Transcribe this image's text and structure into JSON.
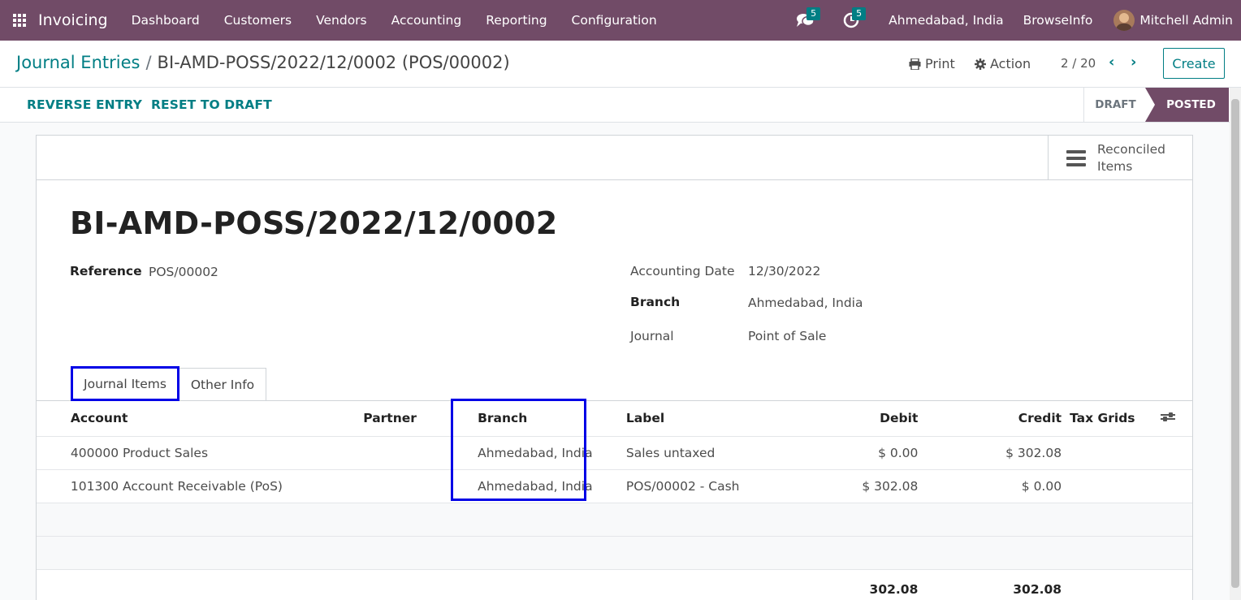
{
  "navbar": {
    "app_name": "Invoicing",
    "menu": [
      "Dashboard",
      "Customers",
      "Vendors",
      "Accounting",
      "Reporting",
      "Configuration"
    ],
    "messages_count": "5",
    "activities_count": "5",
    "branch": "Ahmedabad, India",
    "company": "BrowseInfo",
    "user": "Mitchell Admin"
  },
  "breadcrumb": {
    "parent": "Journal Entries",
    "separator": "/",
    "current": "BI-AMD-POSS/2022/12/0002 (POS/00002)"
  },
  "actions": {
    "print": "Print",
    "action": "Action",
    "pager": "2 / 20",
    "create": "Create"
  },
  "statusbar": {
    "reverse_entry": "REVERSE ENTRY",
    "reset_to_draft": "RESET TO DRAFT",
    "stages": [
      "DRAFT",
      "POSTED"
    ],
    "current_stage": "POSTED"
  },
  "smart_button": {
    "label_line1": "Reconciled",
    "label_line2": "Items"
  },
  "form": {
    "title": "BI-AMD-POSS/2022/12/0002",
    "reference_label": "Reference",
    "reference": "POS/00002",
    "accounting_date_label": "Accounting Date",
    "accounting_date": "12/30/2022",
    "branch_label": "Branch",
    "branch": "Ahmedabad, India",
    "journal_label": "Journal",
    "journal": "Point of Sale"
  },
  "tabs": [
    "Journal Items",
    "Other Info"
  ],
  "table": {
    "headers": {
      "account": "Account",
      "partner": "Partner",
      "branch": "Branch",
      "label": "Label",
      "debit": "Debit",
      "credit": "Credit",
      "tax_grids": "Tax Grids"
    },
    "rows": [
      {
        "account": "400000 Product Sales",
        "partner": "",
        "branch": "Ahmedabad, India",
        "label": "Sales untaxed",
        "debit": "$ 0.00",
        "credit": "$ 302.08",
        "tax_grids": ""
      },
      {
        "account": "101300 Account Receivable (PoS)",
        "partner": "",
        "branch": "Ahmedabad, India",
        "label": "POS/00002 - Cash",
        "debit": "$ 302.08",
        "credit": "$ 0.00",
        "tax_grids": ""
      }
    ],
    "totals": {
      "debit": "302.08",
      "credit": "302.08"
    }
  }
}
